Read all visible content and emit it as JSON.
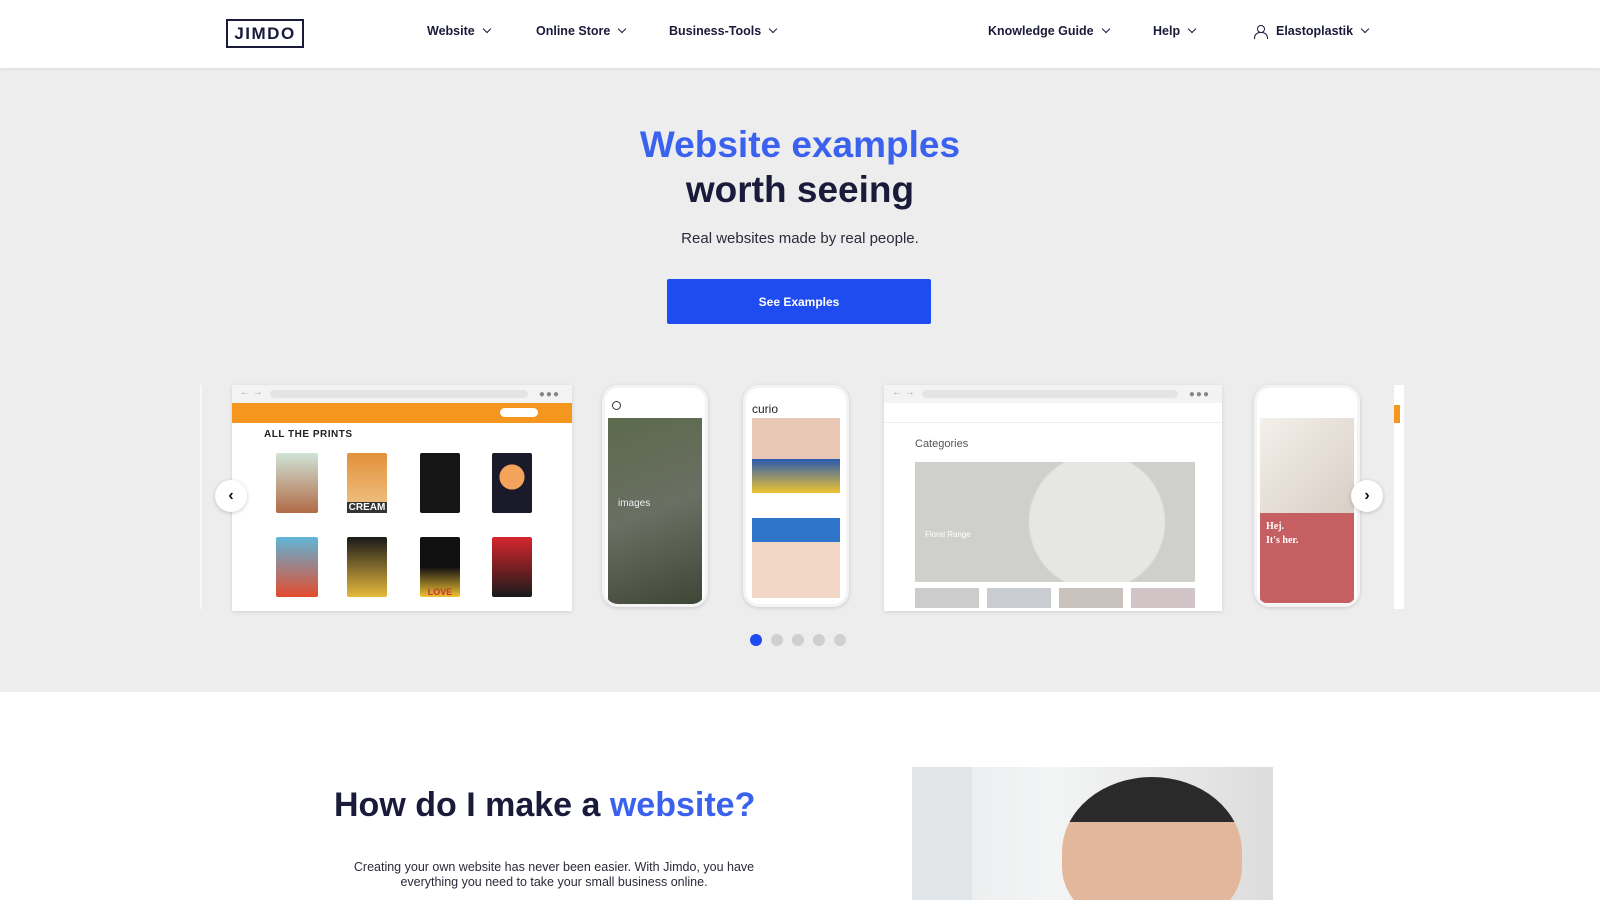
{
  "nav": {
    "logo": "JIMDO",
    "items": [
      {
        "label": "Website"
      },
      {
        "label": "Online Store"
      },
      {
        "label": "Business-Tools"
      },
      {
        "label": "Knowledge Guide"
      },
      {
        "label": "Help"
      }
    ],
    "account": "Elastoplastik"
  },
  "hero": {
    "title_line1": "Website examples",
    "title_line2": "worth seeing",
    "subtitle": "Real websites made by real people.",
    "cta": "See Examples"
  },
  "carousel": {
    "slides": {
      "prints": {
        "heading": "ALL THE PRINTS",
        "poster_text": "CREAM",
        "poster_text2": "LOVE"
      },
      "phone_images": {
        "text": "images"
      },
      "curio": {
        "brand": "curio"
      },
      "categories": {
        "heading": "Categories",
        "feature": "Floral Range"
      },
      "hej": {
        "line1": "Hej.",
        "line2": "It's her."
      }
    },
    "dot_count": 5,
    "active_dot": 0
  },
  "section2": {
    "title_part1": "How do I make a",
    "title_part2": "website?",
    "paragraph": "Creating your own website has never been easier. With Jimdo, you have everything you need to take your small business online."
  },
  "colors": {
    "accent": "#3a62ee",
    "button": "#1f4cf0",
    "hero_bg": "#ededed",
    "text": "#1a1a3a"
  }
}
